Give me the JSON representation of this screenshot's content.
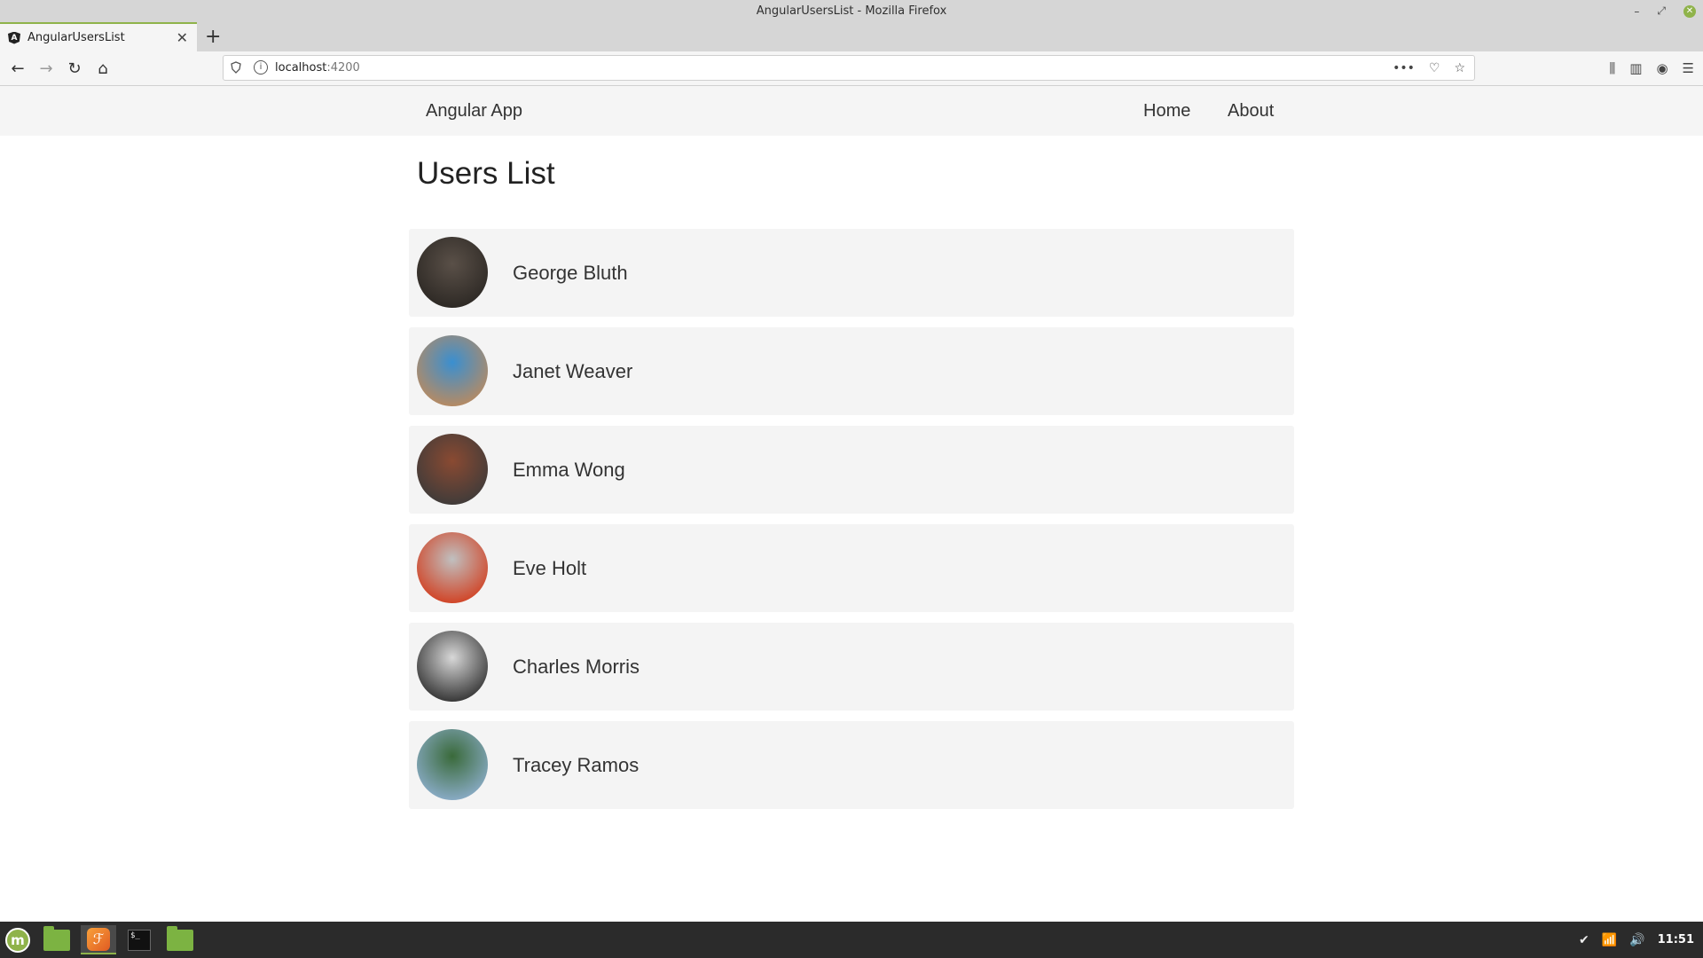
{
  "window": {
    "title": "AngularUsersList - Mozilla Firefox",
    "minimize_glyph": "–",
    "restore_glyph": "⤢",
    "close_glyph": "✕"
  },
  "tab": {
    "favicon_glyph": "A",
    "title": "AngularUsersList",
    "close_glyph": "✕",
    "new_tab_glyph": "+"
  },
  "toolbar": {
    "back_glyph": "←",
    "forward_glyph": "→",
    "reload_glyph": "↻",
    "home_glyph": "⌂",
    "url_host": "localhost",
    "url_port": ":4200",
    "page_actions_glyph": "•••",
    "pocket_glyph": "♡",
    "bookmark_glyph": "☆",
    "library_glyph": "⫼",
    "sidebar_glyph": "▥",
    "account_glyph": "◉",
    "menu_glyph": "☰"
  },
  "app": {
    "brand": "Angular App",
    "nav": [
      {
        "label": "Home"
      },
      {
        "label": "About"
      }
    ],
    "page_title": "Users List"
  },
  "users": [
    {
      "name": "George Bluth",
      "avatar_colors": [
        "#5a5048",
        "#2a2622"
      ]
    },
    {
      "name": "Janet Weaver",
      "avatar_colors": [
        "#3a8fd0",
        "#c08a5a"
      ]
    },
    {
      "name": "Emma Wong",
      "avatar_colors": [
        "#8a4a32",
        "#3a3a3a"
      ]
    },
    {
      "name": "Eve Holt",
      "avatar_colors": [
        "#c0c0c0",
        "#d23a1a"
      ]
    },
    {
      "name": "Charles Morris",
      "avatar_colors": [
        "#d8d8d8",
        "#2a2a2a"
      ]
    },
    {
      "name": "Tracey Ramos",
      "avatar_colors": [
        "#3a6a3a",
        "#8fb0d0"
      ]
    }
  ],
  "taskbar": {
    "menu_glyph": "m",
    "firefox_glyph": "ℱ",
    "terminal_glyph": "$_",
    "tray": {
      "shield_glyph": "✔",
      "wifi_glyph": "📶",
      "volume_glyph": "🔊",
      "clock": "11:51"
    }
  },
  "colors": {
    "accent": "#8fb34a",
    "header_bg": "#f5f5f5",
    "card_bg": "#f4f4f4",
    "taskbar_bg": "#2b2b2b"
  }
}
